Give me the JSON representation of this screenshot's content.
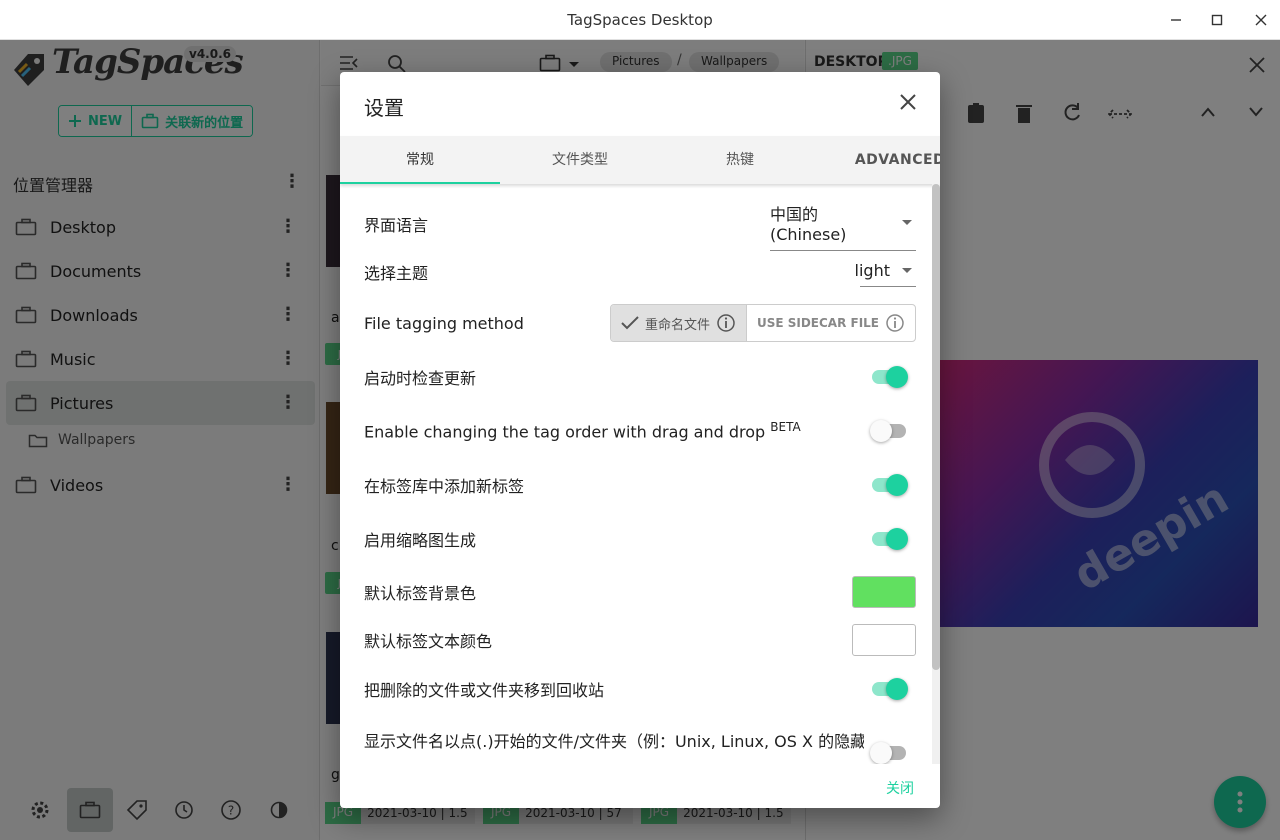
{
  "window": {
    "title": "TagSpaces Desktop"
  },
  "sidebar": {
    "logo_text": "TagSpaces",
    "version": "v4.0.6",
    "new_label": "NEW",
    "connect_label": "关联新的位置",
    "locations_header": "位置管理器",
    "locations": [
      {
        "label": "Desktop"
      },
      {
        "label": "Documents"
      },
      {
        "label": "Downloads"
      },
      {
        "label": "Music"
      },
      {
        "label": "Pictures",
        "active": true
      },
      {
        "label": "Videos"
      }
    ],
    "subfolder": "Wallpapers"
  },
  "files": {
    "breadcrumb": [
      "Pictures",
      "Wallpapers"
    ],
    "ext": "JPG",
    "dates": [
      "2021-03-10 | 1.5",
      "2021-03-10 | 57",
      "2021-03-10 | 1.5"
    ],
    "name_fragments": [
      "a",
      "c",
      "g"
    ]
  },
  "preview": {
    "title": "DESKTOP",
    "ext": ".JPG",
    "image_text": "deepin"
  },
  "dialog": {
    "title": "设置",
    "tabs": [
      "常规",
      "文件类型",
      "热键",
      "ADVANCED"
    ],
    "active_tab": 0,
    "settings": {
      "language": {
        "label": "界面语言",
        "value": "中国的 (Chinese)"
      },
      "theme": {
        "label": "选择主题",
        "value": "light"
      },
      "tagging": {
        "label": "File tagging method",
        "option_rename": "重命名文件",
        "option_sidecar": "USE SIDECAR FILE",
        "selected": "rename"
      },
      "check_updates": {
        "label": "启动时检查更新",
        "on": true
      },
      "drag_tags": {
        "label": "Enable changing the tag order with drag and drop",
        "badge": "BETA",
        "on": false
      },
      "add_tags_library": {
        "label": "在标签库中添加新标签",
        "on": true
      },
      "thumbnails": {
        "label": "启用缩略图生成",
        "on": true
      },
      "tag_bg_color": {
        "label": "默认标签背景色",
        "color": "#61e060"
      },
      "tag_text_color": {
        "label": "默认标签文本颜色",
        "color": "#ffffff"
      },
      "trash": {
        "label": "把删除的文件或文件夹移到回收站",
        "on": true
      },
      "hidden_files": {
        "label": "显示文件名以点(.)开始的文件/文件夹（例：Unix, Linux, OS X 的隐藏",
        "on": false
      }
    },
    "close_label": "关闭"
  },
  "colors": {
    "accent": "#1dd19f",
    "tag_green": "#5ad88a"
  }
}
